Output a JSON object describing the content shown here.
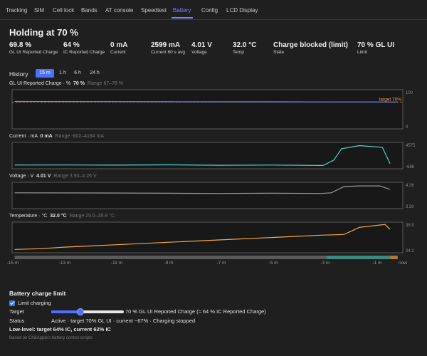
{
  "nav": {
    "tabs": [
      "Tracking",
      "SIM",
      "Cell lock",
      "Bands",
      "AT console",
      "Speedtest",
      "Battery",
      "Config",
      "LCD Display"
    ],
    "active": "Battery",
    "accent": "#6f8bff"
  },
  "header": {
    "title": "Holding at 70 %"
  },
  "stats": [
    {
      "value": "69.8 %",
      "label": "GL UI Reported Charge"
    },
    {
      "value": "64 %",
      "label": "IC Reported Charge"
    },
    {
      "value": "0 mA",
      "label": "Current"
    },
    {
      "value": "2599 mA",
      "label": "Current 60 s avg"
    },
    {
      "value": "4.01 V",
      "label": "Voltage"
    },
    {
      "value": "32.0 °C",
      "label": "Temp"
    },
    {
      "value": "Charge blocked (limit)",
      "label": "State"
    },
    {
      "value": "70 % GL UI",
      "label": "Limit"
    }
  ],
  "history": {
    "title": "History",
    "ranges": [
      "15 m",
      "1 h",
      "6 h",
      "24 h"
    ],
    "active_range": "15 m",
    "x_ticks": [
      "-15 m",
      "-13 m",
      "-11 m",
      "-9 m",
      "-7 m",
      "-5 m",
      "-3 m",
      "-1 m",
      "now"
    ],
    "state_bar": {
      "segments": [
        {
          "label": "blocked",
          "from": -15,
          "to": -2.8,
          "color": "#5a5a5a"
        },
        {
          "label": "charging",
          "from": -2.8,
          "to": -0.3,
          "color": "#3a8a80"
        },
        {
          "label": "hold",
          "from": -0.3,
          "to": 0,
          "color": "#b07a30"
        }
      ]
    }
  },
  "chart_data": [
    {
      "type": "line",
      "title": "GL UI Reported Charge",
      "unit": "%",
      "current": "70 %",
      "range_text": "Range 67–78 %",
      "color": "#6f8bff",
      "ylim": [
        0,
        100
      ],
      "y_ticks": [
        "100",
        "0"
      ],
      "target_label": "target 70%",
      "target_value": 70,
      "x": [
        -15,
        -9,
        -5,
        -3,
        -1,
        0
      ],
      "y": [
        71.5,
        70.8,
        70.5,
        70.2,
        70.1,
        70.0
      ]
    },
    {
      "type": "line",
      "title": "Current",
      "unit": "mA",
      "current": "0 mA",
      "range_text": "Range -602–4184 mA",
      "color": "#4fd6c8",
      "ylim": [
        -602,
        4575
      ],
      "y_ticks": [
        "4575",
        "-686"
      ],
      "x": [
        -15,
        -13,
        -11,
        -9,
        -7,
        -5,
        -3,
        -2.9,
        -2.5,
        -2.2,
        -1.5,
        -0.8,
        -0.6,
        -0.3
      ],
      "y": [
        -100,
        -80,
        -120,
        -60,
        -150,
        -100,
        -200,
        -150,
        1000,
        3500,
        4184,
        3900,
        3800,
        200
      ]
    },
    {
      "type": "line",
      "title": "Voltage",
      "unit": "V",
      "current": "4.01 V",
      "range_text": "Range 3.90–4.26 V",
      "color": "#9a9a9a",
      "ylim": [
        3.3,
        4.36
      ],
      "y_ticks": [
        "4.36",
        "3.30"
      ],
      "x": [
        -15,
        -11,
        -9,
        -7,
        -5,
        -3,
        -2.6,
        -2.1,
        -1.5,
        -0.7,
        -0.3
      ],
      "y": [
        3.95,
        3.94,
        3.93,
        3.92,
        3.93,
        3.92,
        3.95,
        4.23,
        4.26,
        4.26,
        4.1
      ]
    },
    {
      "type": "line",
      "title": "Temperature",
      "unit": "°C",
      "current": "32.0 °C",
      "range_text": "Range 25.0–35.9 °C",
      "color": "#f2a84a",
      "ylim": [
        24.2,
        35.9
      ],
      "y_ticks": [
        "35.9",
        "24.2"
      ],
      "x": [
        -15,
        -14,
        -13,
        -11,
        -9,
        -7,
        -5,
        -4,
        -3,
        -2.1,
        -1.5,
        -0.5,
        -0.3
      ],
      "y": [
        25.0,
        25.3,
        26.0,
        27.0,
        28.0,
        29.0,
        30.0,
        30.5,
        31.0,
        31.3,
        34.3,
        35.5,
        33.5
      ]
    }
  ],
  "battery_limit": {
    "title": "Battery charge limit",
    "checkbox_label": "Limit charging",
    "checkbox_checked": true,
    "target_label": "Target",
    "slider_value": 40,
    "target_text": "70 % GL UI Reported Charge (≈ 64 % IC Reported Charge)",
    "status_label": "Status",
    "status_text": "Active · target 70% GL UI · current ~67% · Charging stopped",
    "low_level": "Low-level: target 64% IC, current 62% IC",
    "footer": "Based on ChiliApple's battery control scripts"
  }
}
